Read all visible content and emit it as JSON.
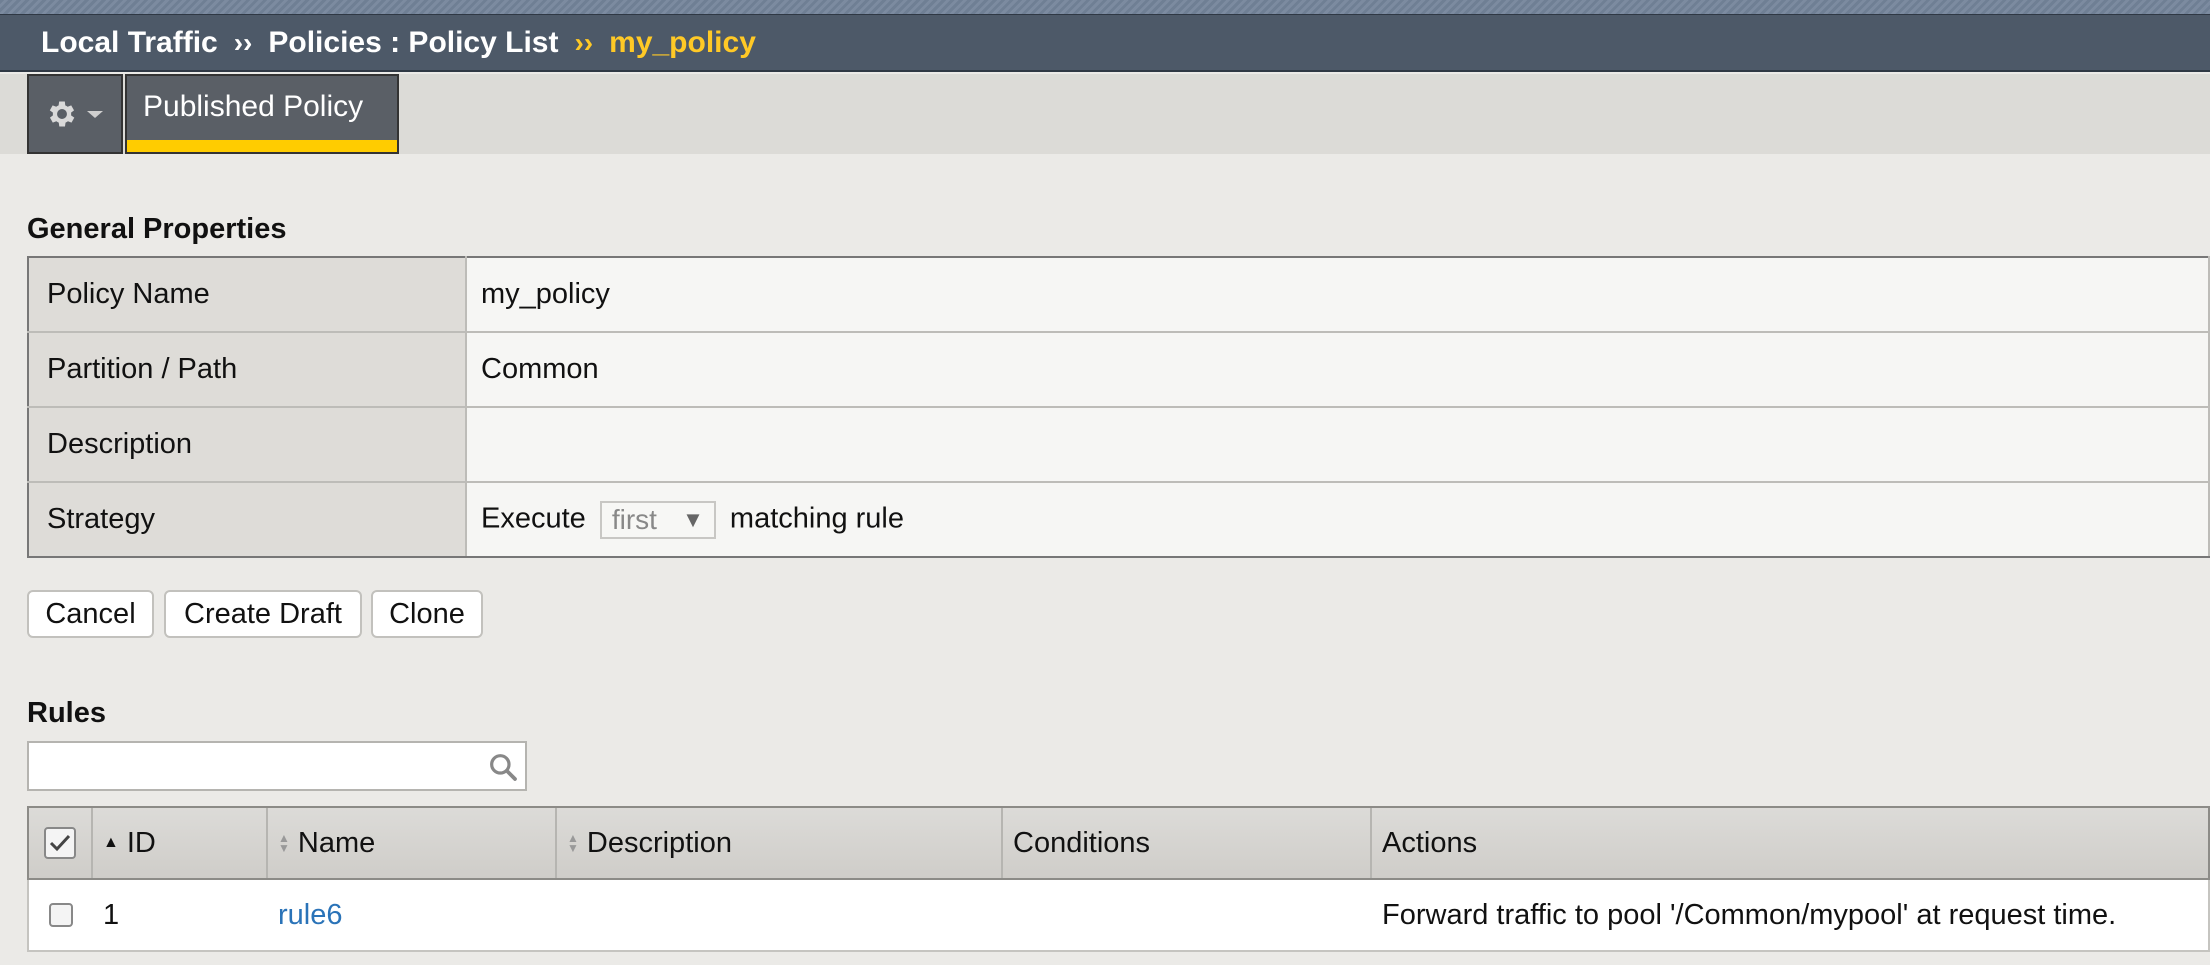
{
  "breadcrumb": {
    "items": [
      "Local Traffic",
      "Policies : Policy List"
    ],
    "separator": "››",
    "current": "my_policy"
  },
  "tabs": {
    "gear_icon": "gear-icon",
    "published_label": "Published Policy"
  },
  "general": {
    "title": "General Properties",
    "rows": [
      {
        "label": "Policy Name",
        "value": "my_policy"
      },
      {
        "label": "Partition / Path",
        "value": "Common"
      },
      {
        "label": "Description",
        "value": ""
      },
      {
        "label": "Strategy",
        "prefix": "Execute",
        "select_value": "first",
        "suffix": "matching rule"
      }
    ]
  },
  "buttons": {
    "cancel": "Cancel",
    "create_draft": "Create Draft",
    "clone": "Clone"
  },
  "rules": {
    "title": "Rules",
    "search": {
      "value": "",
      "placeholder": ""
    },
    "columns": [
      "ID",
      "Name",
      "Description",
      "Conditions",
      "Actions"
    ],
    "rows": [
      {
        "id": "1",
        "name": "rule6",
        "description": "",
        "conditions": "",
        "actions": "Forward traffic to pool '/Common/mypool' at request time."
      }
    ]
  },
  "colors": {
    "accent_yellow": "#ffc926",
    "header_bg": "#4d5968",
    "link_blue": "#2a73b8"
  }
}
